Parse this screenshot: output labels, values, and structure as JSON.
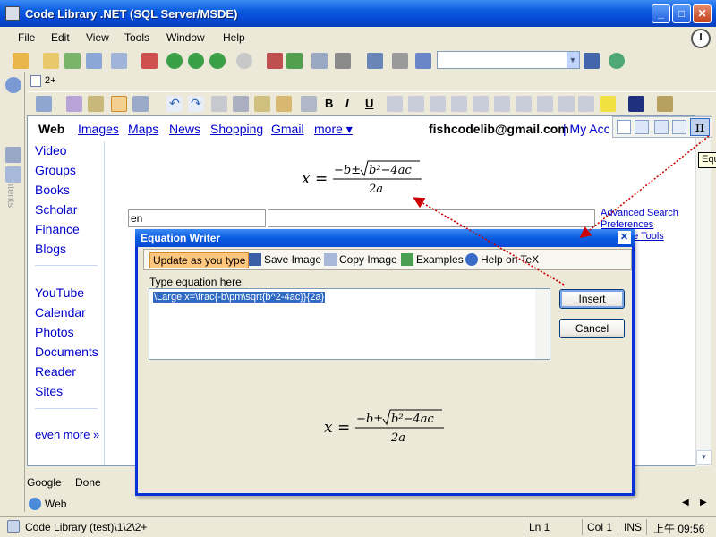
{
  "window": {
    "title": "Code Library .NET (SQL Server/MSDE)"
  },
  "menu": [
    "File",
    "Edit",
    "View",
    "Tools",
    "Window",
    "Help"
  ],
  "tab": {
    "label": "2+"
  },
  "sidebar": {
    "label": "Contents"
  },
  "google": {
    "top_links": [
      "Web",
      "Images",
      "Maps",
      "News",
      "Shopping",
      "Gmail",
      "more ▾"
    ],
    "user": "fishcodelib@gmail.com",
    "account": "| My Acc",
    "side_links_1": [
      "Video",
      "Groups",
      "Books",
      "Scholar",
      "Finance",
      "Blogs"
    ],
    "side_links_2": [
      "YouTube",
      "Calendar",
      "Photos",
      "Documents",
      "Reader",
      "Sites"
    ],
    "even_more": "even more »",
    "lang_value": "en",
    "right_links": [
      "Advanced Search",
      "Preferences",
      "ge Tools"
    ]
  },
  "tooltip": "Equ",
  "doc_status": {
    "left": "Google",
    "right": "Done"
  },
  "bottom_tab": "Web",
  "statusbar": {
    "path": "Code Library (test)\\1\\2\\2+",
    "line": "Ln 1",
    "col": "Col 1",
    "mode": "INS",
    "time": "上午 09:56"
  },
  "dialog": {
    "title": "Equation Writer",
    "toolbar": {
      "update": "Update as you type",
      "save": "Save Image",
      "copy": "Copy Image",
      "examples": "Examples",
      "help": "Help on TeX"
    },
    "label": "Type equation here:",
    "equation_text": "\\Large x=\\frac{-b\\pm\\sqrt{b^2-4ac}}{2a}",
    "insert": "Insert",
    "cancel": "Cancel"
  },
  "formula": {
    "lhs": "x =",
    "num_a": "−b±",
    "sqrt": "√",
    "radicand": "b²−4ac",
    "den": "2a"
  },
  "colors": {
    "title_blue": "#0a5ce0",
    "link": "#0000cc",
    "arrow": "#cc0000"
  }
}
